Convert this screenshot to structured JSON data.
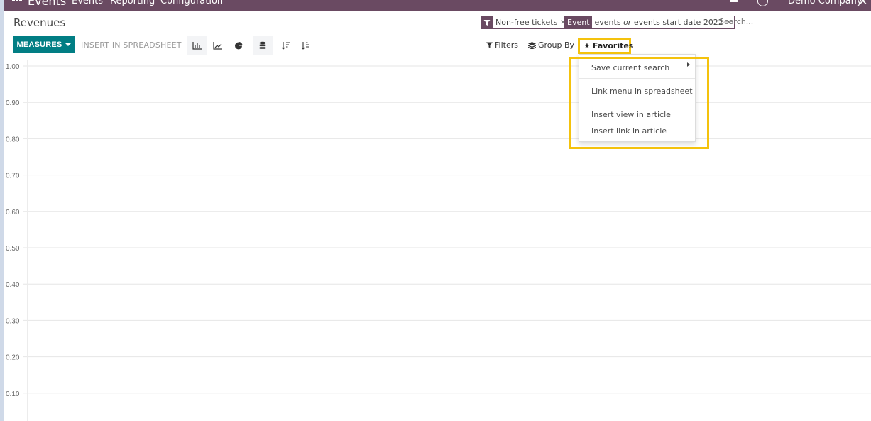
{
  "navbar": {
    "brand": "Events",
    "menus": [
      "Events",
      "Reporting",
      "Configuration"
    ],
    "company": "Demo Company"
  },
  "page": {
    "title": "Revenues"
  },
  "toolbar": {
    "measures_label": "MEASURES",
    "insert_label": "INSERT IN SPREADSHEET",
    "view_buttons": [
      {
        "name": "bar-chart",
        "active": true
      },
      {
        "name": "line-chart",
        "active": false
      },
      {
        "name": "pie-chart",
        "active": false
      },
      {
        "name": "stacked",
        "active": true
      },
      {
        "name": "sort-descending",
        "active": false
      },
      {
        "name": "sort-ascending",
        "active": false
      }
    ]
  },
  "search": {
    "facets": [
      {
        "label_icon": "filter-icon",
        "value": "Non-free tickets"
      },
      {
        "label": "Event",
        "value_parts": [
          "events ",
          "or",
          " events start date 2022"
        ]
      }
    ],
    "placeholder": "Search...",
    "filters_label": "Filters",
    "groupby_label": "Group By",
    "favorites_label": "Favorites",
    "accent_color": "#6a4a62"
  },
  "favorites_menu": {
    "items": [
      {
        "label": "Save current search",
        "submenu": true
      },
      {
        "label": "Link menu in spreadsheet"
      },
      {
        "label": "Insert view in article"
      },
      {
        "label": "Insert link in article"
      }
    ],
    "highlight_color": "#f4c20d"
  },
  "chart_data": {
    "type": "bar",
    "title": "",
    "xlabel": "",
    "ylabel": "",
    "categories": [],
    "series": [],
    "ylim": [
      0,
      1
    ],
    "yticks": [
      "1.00",
      "0.90",
      "0.80",
      "0.70",
      "0.60",
      "0.50",
      "0.40",
      "0.30",
      "0.20",
      "0.10"
    ],
    "grid": true,
    "legend": "none"
  },
  "colors": {
    "primary": "#017e84",
    "navbar": "#6a4a62"
  }
}
